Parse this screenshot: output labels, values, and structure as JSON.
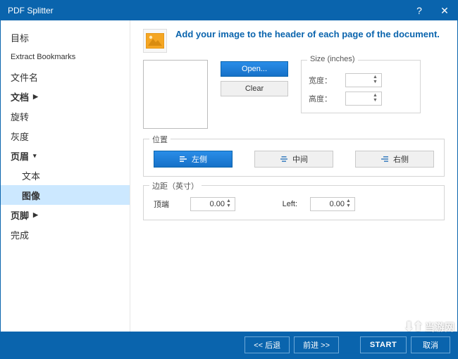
{
  "window": {
    "title": "PDF Splitter"
  },
  "titlebar": {
    "help": "?",
    "close": "✕"
  },
  "sidebar": {
    "items": [
      {
        "label": "目标",
        "hasChildren": false
      },
      {
        "label": "Extract Bookmarks",
        "hasChildren": false
      },
      {
        "label": "文件名",
        "hasChildren": false
      },
      {
        "label": "文档",
        "hasChildren": true
      },
      {
        "label": "旋转",
        "hasChildren": false
      },
      {
        "label": "灰度",
        "hasChildren": false
      },
      {
        "label": "页眉",
        "hasChildren": true
      },
      {
        "label": "文本",
        "child": true
      },
      {
        "label": "图像",
        "child": true,
        "selected": true
      },
      {
        "label": "页脚",
        "hasChildren": true
      },
      {
        "label": "完成",
        "hasChildren": false
      }
    ]
  },
  "header": {
    "line": "Add your image to the header of each page of the document."
  },
  "buttons": {
    "open": "Open...",
    "clear": "Clear"
  },
  "sizeGroup": {
    "title": "Size (inches)",
    "widthLabel": "宽度：",
    "heightLabel": "高度：",
    "widthValue": "",
    "heightValue": ""
  },
  "positionGroup": {
    "title": "位置",
    "left": "左侧",
    "center": "中间",
    "right": "右侧"
  },
  "marginGroup": {
    "title": "边距（英寸）",
    "topLabel": "顶端",
    "topValue": "0.00",
    "leftLabel": "Left:",
    "leftValue": "0.00"
  },
  "footer": {
    "back": "<<  后退",
    "next": "前进  >>",
    "start": "START",
    "cancel": "取消"
  },
  "watermark": {
    "text": "当游网"
  }
}
